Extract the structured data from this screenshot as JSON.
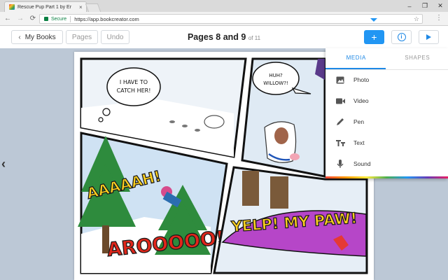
{
  "browser": {
    "tab_title": "Rescue Pup Part 1 by Er",
    "tab_close": "×",
    "secure_label": "Secure",
    "url": "https://app.bookcreator.com",
    "window_controls": [
      "–",
      "❐",
      "✕"
    ]
  },
  "appbar": {
    "my_books_label": "My Books",
    "pages_label": "Pages",
    "undo_label": "Undo",
    "page_title": "Pages 8 and 9",
    "page_count": "of 11",
    "add_label": "+",
    "info_label": "i"
  },
  "comic": {
    "bubble1": [
      "I HAVE TO",
      "CATCH HER!"
    ],
    "bubble2": [
      "HUH?",
      "WILLOW?!"
    ],
    "sfx_scream": "AAAAAH!",
    "sfx_howl": "AROOOOO!",
    "sfx_yelp": "YELP! MY PAW!"
  },
  "panel": {
    "tabs": [
      {
        "label": "MEDIA",
        "active": true
      },
      {
        "label": "SHAPES",
        "active": false
      }
    ],
    "items": [
      {
        "label": "Photo",
        "icon": "image-icon"
      },
      {
        "label": "Video",
        "icon": "video-camera-icon"
      },
      {
        "label": "Pen",
        "icon": "pen-icon"
      },
      {
        "label": "Text",
        "icon": "text-icon"
      },
      {
        "label": "Sound",
        "icon": "microphone-icon"
      }
    ]
  },
  "colors": {
    "accent": "#2196f3",
    "background": "#bcc8d6",
    "sfx_yellow": "#ffd21f",
    "sfx_red": "#e0261b"
  }
}
